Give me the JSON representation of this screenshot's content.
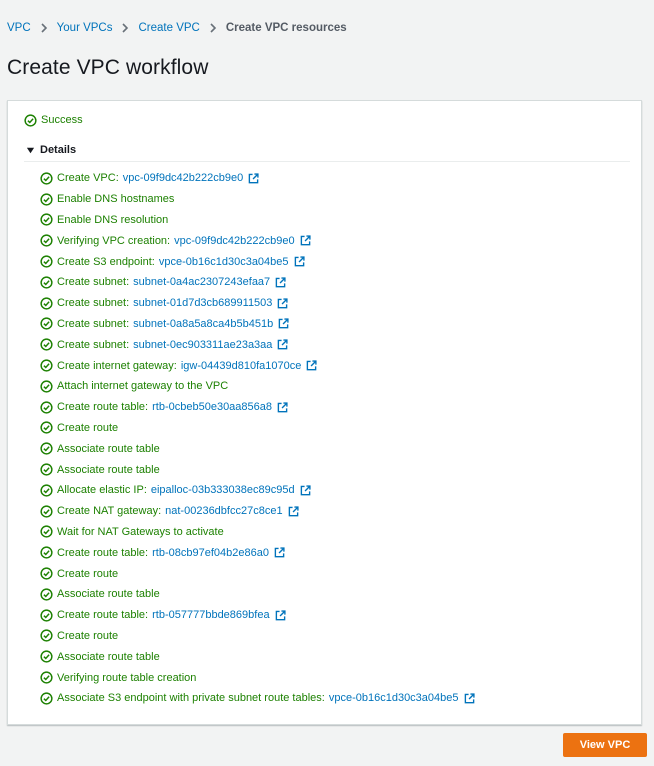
{
  "breadcrumb": {
    "items": [
      "VPC",
      "Your VPCs",
      "Create VPC"
    ],
    "current": "Create VPC resources"
  },
  "page": {
    "title": "Create VPC workflow"
  },
  "status": {
    "text": "Success",
    "color": "#1d8102"
  },
  "details": {
    "label": "Details"
  },
  "steps": [
    {
      "text": "Create VPC:",
      "link": "vpc-09f9dc42b222cb9e0"
    },
    {
      "text": "Enable DNS hostnames"
    },
    {
      "text": "Enable DNS resolution"
    },
    {
      "text": "Verifying VPC creation:",
      "link": "vpc-09f9dc42b222cb9e0"
    },
    {
      "text": "Create S3 endpoint:",
      "link": "vpce-0b16c1d30c3a04be5"
    },
    {
      "text": "Create subnet:",
      "link": "subnet-0a4ac2307243efaa7"
    },
    {
      "text": "Create subnet:",
      "link": "subnet-01d7d3cb689911503"
    },
    {
      "text": "Create subnet:",
      "link": "subnet-0a8a5a8ca4b5b451b"
    },
    {
      "text": "Create subnet:",
      "link": "subnet-0ec903311ae23a3aa"
    },
    {
      "text": "Create internet gateway:",
      "link": "igw-04439d810fa1070ce"
    },
    {
      "text": "Attach internet gateway to the VPC"
    },
    {
      "text": "Create route table:",
      "link": "rtb-0cbeb50e30aa856a8"
    },
    {
      "text": "Create route"
    },
    {
      "text": "Associate route table"
    },
    {
      "text": "Associate route table"
    },
    {
      "text": "Allocate elastic IP:",
      "link": "eipalloc-03b333038ec89c95d"
    },
    {
      "text": "Create NAT gateway:",
      "link": "nat-00236dbfcc27c8ce1"
    },
    {
      "text": "Wait for NAT Gateways to activate"
    },
    {
      "text": "Create route table:",
      "link": "rtb-08cb97ef04b2e86a0"
    },
    {
      "text": "Create route"
    },
    {
      "text": "Associate route table"
    },
    {
      "text": "Create route table:",
      "link": "rtb-057777bbde869bfea"
    },
    {
      "text": "Create route"
    },
    {
      "text": "Associate route table"
    },
    {
      "text": "Verifying route table creation"
    },
    {
      "text": "Associate S3 endpoint with private subnet route tables:",
      "link": "vpce-0b16c1d30c3a04be5"
    }
  ],
  "actions": {
    "view_vpc": "View VPC"
  },
  "colors": {
    "link": "#0073bb",
    "success": "#1d8102",
    "primary_button": "#ec7211",
    "background": "#f2f3f3"
  },
  "icons": {
    "step": "status-success-icon",
    "link": "external-link-icon",
    "separator": "chevron-right-icon",
    "details": "caret-down-icon"
  }
}
